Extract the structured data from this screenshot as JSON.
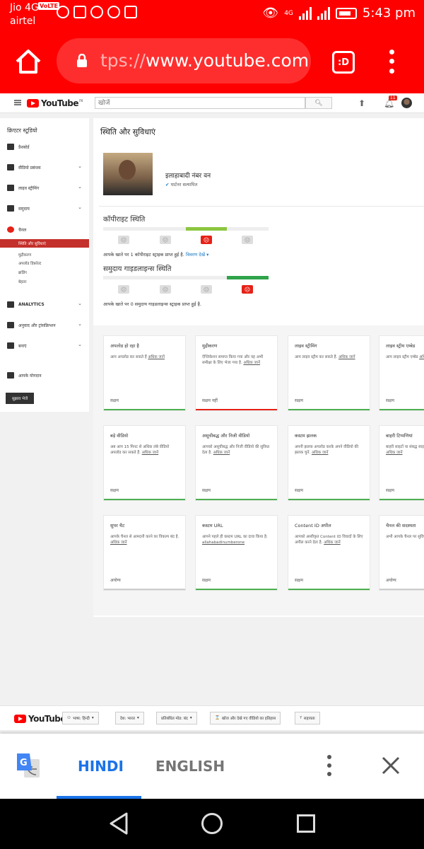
{
  "status_bar": {
    "carrier1": "Jio 4G",
    "volte": "VoLTE",
    "carrier2": "airtel",
    "net": "4G",
    "time": "5:43 pm"
  },
  "browser": {
    "url_dim": "tps://",
    "url_main": "www.youtube.com",
    "tab_label": ":D"
  },
  "yt": {
    "logo": "YouTube",
    "logo_sup": "IN",
    "search_placeholder": "खोजें",
    "notif_count": "11"
  },
  "sidebar": {
    "title": "क्रिएटर स्टूडियो",
    "items": [
      {
        "label": "डैशबोर्ड"
      },
      {
        "label": "वीडियो प्रबंधक"
      },
      {
        "label": "लाइव स्ट्रीमिंग"
      },
      {
        "label": "समुदाय"
      },
      {
        "label": "चैनल"
      }
    ],
    "channel_subs": [
      "स्थिति और सुविधाएं",
      "मुद्रीकरण",
      "अपलोड डिफ़ॉल्ट",
      "ब्रांडिंग",
      "बेहतर"
    ],
    "more_items": [
      {
        "label": "ANALYTICS"
      },
      {
        "label": "अनुवाद और ट्रांसक्रिप्शन"
      },
      {
        "label": "बनाएं"
      },
      {
        "label": "आपके योगदान"
      }
    ],
    "feedback": "सुझाव भेजें"
  },
  "main": {
    "title": "स्थिति और सुविधाएं",
    "channel_name": "इलाहाबादी नंबर वन",
    "partner": "पार्टनर सत्यापित",
    "copyright_title": "कॉपीराइट स्थिति",
    "copyright_text": "आपके खाते पर 1 कॉपीराइट स्ट्राइक प्राप्त हुई है.",
    "copyright_link": "विवरण देखें ▾",
    "community_title": "समुदाय गाइडलाइन्स स्थिति",
    "community_text": "आपके खाते पर 0 समुदाय गाइडलाइन्स स्ट्राइक प्राप्त हुई है."
  },
  "cards": [
    {
      "title": "अपलोड हो रहा है",
      "desc": "आप अपलोड कर सकते हैं",
      "link": "अधिक जानें",
      "status": "सक्षम",
      "bar": "#4caf50"
    },
    {
      "title": "मुद्रीकरण",
      "desc": "ऐप्लिकेशन समाप्त किया गया और यह अभी समीक्षा के लिए भेजा गया है.",
      "link": "अधिक जानें",
      "status": "सक्षम नहीं",
      "bar": "#e62117"
    },
    {
      "title": "लाइव स्ट्रीमिंग",
      "desc": "आप लाइव स्ट्रीम कर सकते हैं.",
      "link": "अधिक जानें",
      "status": "सक्षम",
      "bar": "#4caf50"
    },
    {
      "title": "लाइव स्ट्रीम एम्बेड",
      "desc": "आप लाइव स्ट्रीम एम्बेड",
      "link": "अधिक जानें",
      "status": "सक्षम",
      "bar": "#4caf50"
    },
    {
      "title": "बड़े वीडियो",
      "desc": "अब आप 15 मिनट से अधिक लंबे वीडियो अपलोड कर सकते हैं.",
      "link": "अधिक जानें",
      "status": "सक्षम",
      "bar": "#4caf50"
    },
    {
      "title": "असूचीबद्ध और निजी वीडियो",
      "desc": "आपको असूचीबद्ध और निजी वीडियो की सुविधा देता है.",
      "link": "अधिक जानें",
      "status": "सक्षम",
      "bar": "#4caf50"
    },
    {
      "title": "कस्टम झलक",
      "desc": "अपनी झलक अपलोड करके अपने वीडियो की झलक चुनें.",
      "link": "अधिक जानें",
      "status": "सक्षम",
      "bar": "#4caf50"
    },
    {
      "title": "बाहरी टिप्पणियां",
      "desc": "बाहरी साइटों या संबद्ध साइट आपको टिप्पणियां",
      "link": "अधिक जानें",
      "status": "सक्षम",
      "bar": "#4caf50"
    },
    {
      "title": "सुपर चैट",
      "desc": "आपके चैनल से आमदनी करने का विकल्प बंद है.",
      "link": "अधिक जानें",
      "status": "अयोग्य",
      "bar": "#cccccc"
    },
    {
      "title": "कस्टम URL",
      "desc": "आपने पहले ही कस्टम URL का दावा किया है:",
      "link": "allahabadinumberone",
      "status": "सक्षम",
      "bar": "#4caf50"
    },
    {
      "title": "Content ID अपील",
      "desc": "आपको अस्वीकृत Content ID विवादों के लिए अपील करने देता है.",
      "link": "अधिक जानें",
      "status": "सक्षम",
      "bar": "#4caf50"
    },
    {
      "title": "चैनल की सदस्यता",
      "desc": "अभी आपके चैनल पर सुविधा उपलब्ध नहीं है",
      "link": "",
      "status": "अयोग्य",
      "bar": "#cccccc"
    }
  ],
  "footer": {
    "logo": "YouTube",
    "language": "भाषा: हिन्दी",
    "country": "देश: भारत",
    "restricted": "प्रतिबंधित मोड: बंद",
    "history": "खोज और देखे गए वीडियो का इतिहास",
    "help": "सहायता"
  },
  "translate": {
    "lang_active": "HINDI",
    "lang_other": "ENGLISH"
  }
}
